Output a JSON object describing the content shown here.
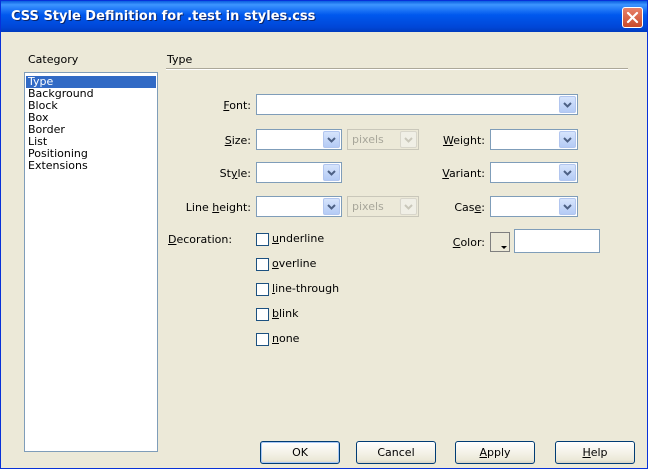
{
  "window": {
    "title": "CSS Style Definition for .test in styles.css"
  },
  "category": {
    "heading": "Category",
    "items": [
      "Type",
      "Background",
      "Block",
      "Box",
      "Border",
      "List",
      "Positioning",
      "Extensions"
    ],
    "selected": "Type"
  },
  "panel": {
    "heading": "Type"
  },
  "fields": {
    "font": {
      "ul": "F",
      "rest": "ont:",
      "value": ""
    },
    "size": {
      "ul": "S",
      "rest": "ize:",
      "value": "",
      "unit": "pixels"
    },
    "style": {
      "pre": "St",
      "ul": "y",
      "rest": "le:",
      "value": ""
    },
    "line_height": {
      "pre": "Line ",
      "ul": "h",
      "rest": "eight:",
      "value": "",
      "unit": "pixels"
    },
    "weight": {
      "ul": "W",
      "rest": "eight:",
      "value": ""
    },
    "variant": {
      "ul": "V",
      "rest": "ariant:",
      "value": ""
    },
    "case": {
      "pre": "Cas",
      "ul": "e",
      "rest": ":",
      "value": ""
    },
    "color": {
      "ul": "C",
      "rest": "olor:",
      "value": ""
    }
  },
  "decoration": {
    "label_pre": "",
    "label_ul": "D",
    "label_rest": "ecoration:",
    "options": [
      {
        "ul": "u",
        "rest": "nderline",
        "checked": false
      },
      {
        "ul": "o",
        "rest": "verline",
        "checked": false
      },
      {
        "ul": "l",
        "rest": "ine-through",
        "checked": false
      },
      {
        "ul": "b",
        "rest": "link",
        "checked": false
      },
      {
        "ul": "n",
        "rest": "one",
        "checked": false
      }
    ]
  },
  "buttons": {
    "ok": "OK",
    "cancel": "Cancel",
    "apply_ul": "A",
    "apply_rest": "pply",
    "help_ul": "H",
    "help_rest": "elp"
  },
  "colors": {
    "title_bar": "#0058ee",
    "selection": "#316ac5",
    "dialog_bg": "#ece9d8"
  },
  "icons": {
    "close": "close-icon",
    "dropdown": "chevron-down-icon",
    "color_swatch": "color-swatch-icon"
  }
}
